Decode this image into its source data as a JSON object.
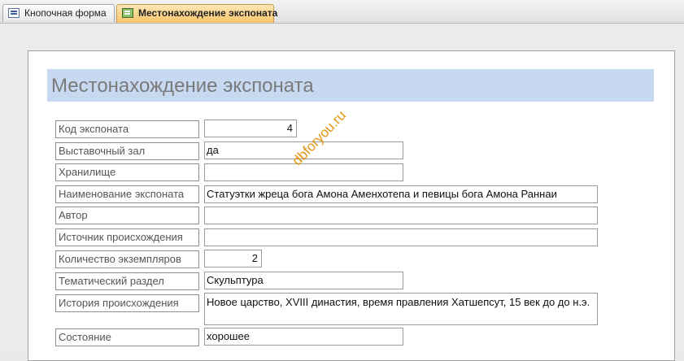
{
  "tabs": [
    {
      "label": "Кнопочная форма",
      "icon": "switchboard-form-icon",
      "active": false
    },
    {
      "label": "Местонахождение экспоната",
      "icon": "form-icon",
      "active": true
    }
  ],
  "form": {
    "title": "Местонахождение экспоната",
    "fields": [
      {
        "label": "Код экспоната",
        "value": "4"
      },
      {
        "label": "Выставочный зал",
        "value": "да"
      },
      {
        "label": "Хранилище",
        "value": ""
      },
      {
        "label": "Наименование экспоната",
        "value": "Статуэтки жреца бога Амона Аменхотепа и певицы бога Амона Раннаи"
      },
      {
        "label": "Автор",
        "value": ""
      },
      {
        "label": "Источник происхождения",
        "value": ""
      },
      {
        "label": "Количество экземпляров",
        "value": "2"
      },
      {
        "label": "Тематический раздел",
        "value": "Скульптура"
      },
      {
        "label": "История происхождения",
        "value": "Новое царство, XVIII династия, время правления Хатшепсут, 15 век до до н.э."
      },
      {
        "label": "Состояние",
        "value": "хорошее"
      }
    ]
  },
  "watermark": "dbforyou.ru",
  "colors": {
    "header_band": "#c6d9f1",
    "active_tab": "#fbc56a",
    "watermark": "#e39410"
  }
}
